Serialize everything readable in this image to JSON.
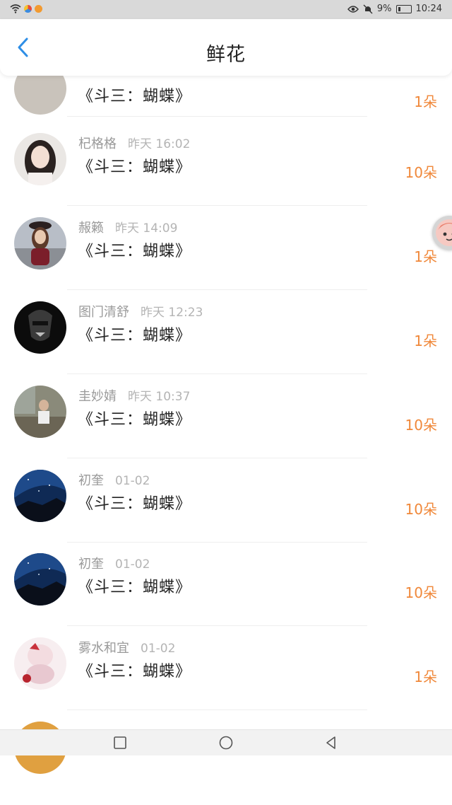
{
  "status_bar": {
    "battery": "9%",
    "time": "10:24"
  },
  "header": {
    "title": "鲜花"
  },
  "gift_records": [
    {
      "user": "",
      "time": "",
      "gift": "《斗三：蝴蝶》",
      "count": "1朵"
    },
    {
      "user": "杞格格",
      "time": "昨天 16:02",
      "gift": "《斗三：蝴蝶》",
      "count": "10朵"
    },
    {
      "user": "赧籁",
      "time": "昨天 14:09",
      "gift": "《斗三：蝴蝶》",
      "count": "1朵"
    },
    {
      "user": "图门清舒",
      "time": "昨天 12:23",
      "gift": "《斗三：蝴蝶》",
      "count": "1朵"
    },
    {
      "user": "圭妙婧",
      "time": "昨天 10:37",
      "gift": "《斗三：蝴蝶》",
      "count": "10朵"
    },
    {
      "user": "初奎",
      "time": "01-02",
      "gift": "《斗三：蝴蝶》",
      "count": "10朵"
    },
    {
      "user": "初奎",
      "time": "01-02",
      "gift": "《斗三：蝴蝶》",
      "count": "10朵"
    },
    {
      "user": "雾水和宜",
      "time": "01-02",
      "gift": "《斗三：蝴蝶》",
      "count": "1朵"
    }
  ],
  "colors": {
    "accent_blue": "#2e8ee6",
    "count_orange": "#f0883a"
  },
  "icons": {
    "back": "chevron-left-icon",
    "nav_recent": "square-icon",
    "nav_home": "circle-icon",
    "nav_back": "triangle-left-icon"
  }
}
